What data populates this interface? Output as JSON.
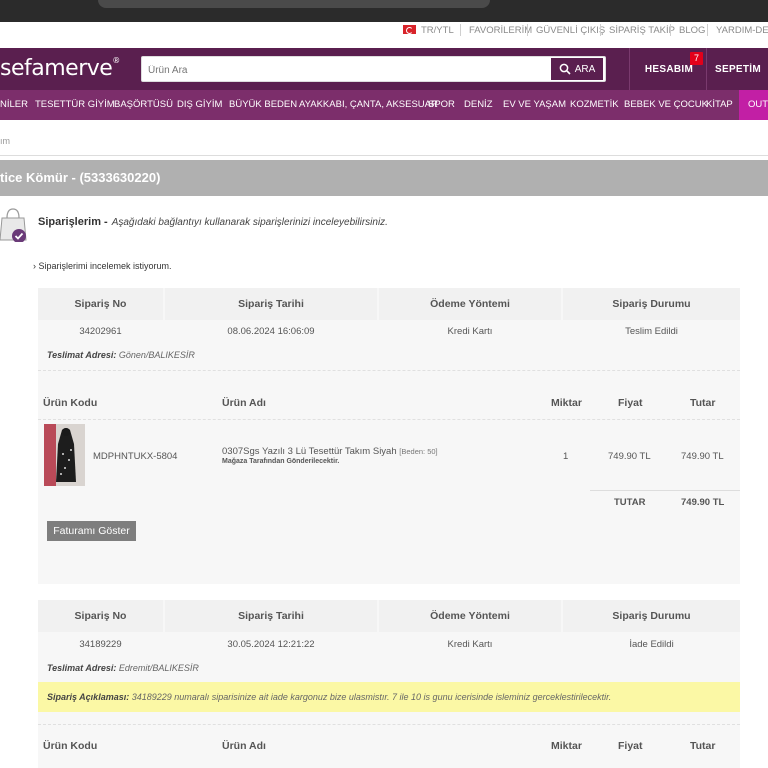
{
  "utility_bar": {
    "lang": "TR/YTL",
    "items": [
      "FAVORİLERİM",
      "GÜVENLİ ÇIKIŞ",
      "SİPARİŞ TAKİP",
      "BLOG",
      "YARDIM-DESTEK"
    ]
  },
  "header": {
    "logo": "sefamerve",
    "search_placeholder": "Ürün Ara",
    "search_button": "ARA",
    "account_label": "HESABIM",
    "account_badge": "7",
    "cart_label": "SEPETİM"
  },
  "categories": [
    "NİLER",
    "TESETTÜR GİYİM",
    "BAŞÖRTÜSÜ",
    "DIŞ GİYİM",
    "BÜYÜK BEDEN",
    "AYAKKABI, ÇANTA, AKSESUAR",
    "SPOR",
    "DENİZ",
    "EV VE YAŞAM",
    "KOZMETİK",
    "BEBEK VE ÇOCUK",
    "KİTAP",
    "OUTLET"
  ],
  "breadcrumb": "ım",
  "user_bar": "tice Kömür - (5333630220)",
  "section": {
    "title": "Siparişlerim -",
    "subtitle": "Aşağıdaki bağlantıyı kullanarak siparişlerinizi inceleyebilirsiniz.",
    "link": "› Siparişlerimi incelemek istiyorum."
  },
  "order_headers": [
    "Sipariş No",
    "Sipariş Tarihi",
    "Ödeme Yöntemi",
    "Sipariş Durumu"
  ],
  "product_headers": [
    "Ürün Kodu",
    "Ürün Adı",
    "Miktar",
    "Fiyat",
    "Tutar"
  ],
  "orders": [
    {
      "order_no": "34202961",
      "date": "08.06.2024 16:06:09",
      "payment": "Kredi Kartı",
      "status": "Teslim Edildi",
      "address_label": "Teslimat Adresi:",
      "address": "Gönen/BALIKESİR",
      "product": {
        "code": "MDPHNTUKX-5804",
        "name": "0307Sgs Yazılı 3 Lü Tesettür Takım Siyah",
        "size": "[Beden: 50]",
        "seller": "Mağaza Tarafından Gönderilecektir.",
        "qty": "1",
        "price": "749.90 TL",
        "total": "749.90 TL"
      },
      "total_label": "TUTAR",
      "total_value": "749.90 TL",
      "invoice_button": "Faturamı Göster"
    },
    {
      "order_no": "34189229",
      "date": "30.05.2024 12:21:22",
      "payment": "Kredi Kartı",
      "status": "İade Edildi",
      "address_label": "Teslimat Adresi:",
      "address": "Edremit/BALIKESİR",
      "note_label": "Sipariş Açıklaması:",
      "note": "34189229 numaralı siparisinize ait iade kargonuz bize ulasmistır. 7 ile 10 is gunu icerisinde isleminiz gerceklestirilecektir."
    }
  ]
}
